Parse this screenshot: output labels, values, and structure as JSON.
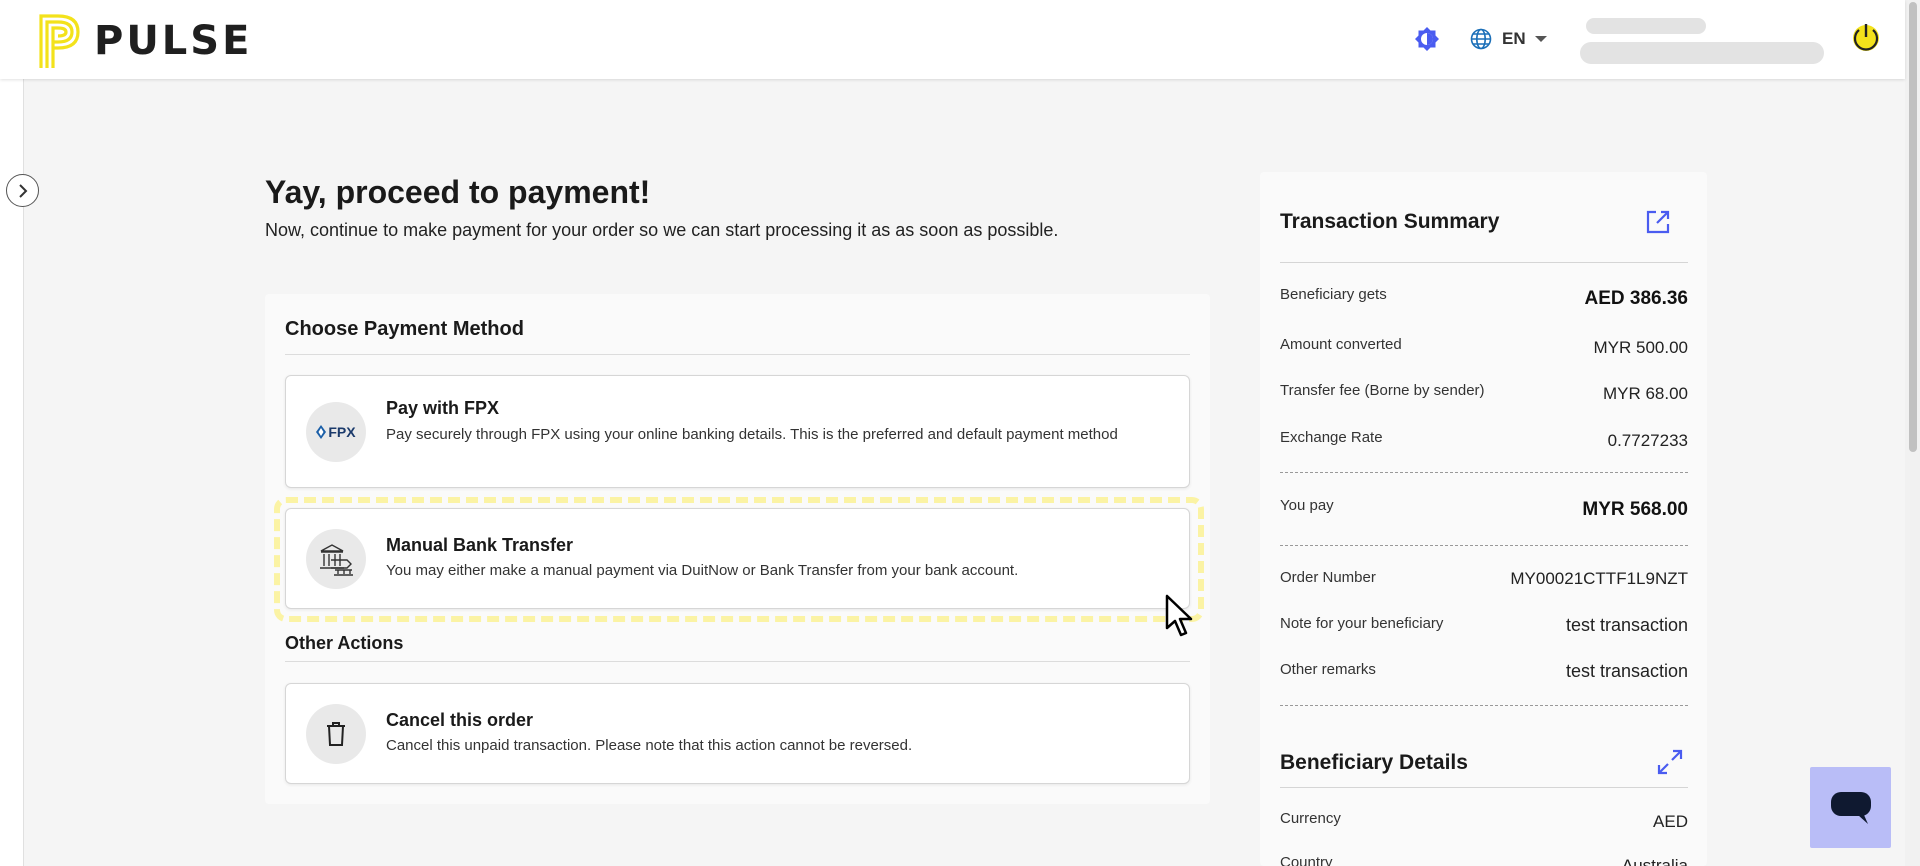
{
  "brand": {
    "name": "PULSE",
    "logo_color": "#f3e21b"
  },
  "header": {
    "theme_icon": "theme-toggle-icon",
    "language": {
      "icon": "globe-icon",
      "value": "EN"
    },
    "power_icon": "power-icon"
  },
  "sidebar": {
    "toggle_icon": "chevron-right-icon"
  },
  "main": {
    "title": "Yay, proceed to payment!",
    "subtitle": "Now, continue to make payment for your order so we can start processing it as as soon as possible."
  },
  "payment": {
    "section_title": "Choose Payment Method",
    "options": [
      {
        "icon_label": "FPX",
        "title": "Pay with FPX",
        "description": "Pay securely through FPX using your online banking details. This is the preferred and default payment method"
      },
      {
        "icon": "bank-transfer-icon",
        "title": "Manual Bank Transfer",
        "description": "You may either make a manual payment via DuitNow or Bank Transfer from your bank account."
      }
    ],
    "other_title": "Other Actions",
    "cancel": {
      "icon": "trash-icon",
      "title": "Cancel this order",
      "description": "Cancel this unpaid transaction. Please note that this action cannot be reversed."
    }
  },
  "summary": {
    "title": "Transaction Summary",
    "rows": [
      {
        "label": "Beneficiary gets",
        "value": "AED 386.36"
      },
      {
        "label": "Amount converted",
        "value": "MYR 500.00"
      },
      {
        "label": "Transfer fee (Borne by sender)",
        "value": "MYR 68.00"
      },
      {
        "label": "Exchange Rate",
        "value": "0.7727233"
      }
    ],
    "you_pay": {
      "label": "You pay",
      "value": "MYR 568.00"
    },
    "details": [
      {
        "label": "Order Number",
        "value": "MY00021CTTF1L9NZT"
      },
      {
        "label": "Note for your beneficiary",
        "value": "test transaction"
      },
      {
        "label": "Other remarks",
        "value": "test transaction"
      }
    ]
  },
  "beneficiary": {
    "title": "Beneficiary Details",
    "rows": [
      {
        "label": "Currency",
        "value": "AED"
      },
      {
        "label": "Country",
        "value": "Australia"
      }
    ]
  },
  "colors": {
    "accent": "#4a5cf0",
    "chat_bg": "#b9bdf7",
    "highlight": "#fbf3a4"
  }
}
